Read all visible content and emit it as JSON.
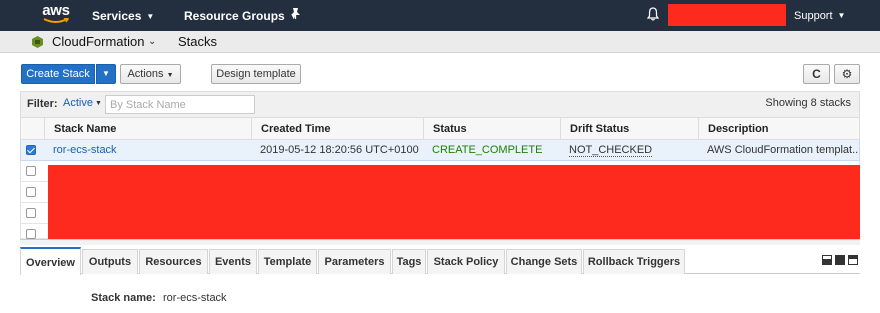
{
  "topnav": {
    "logo_text": "aws",
    "services_label": "Services",
    "resource_groups_label": "Resource Groups",
    "support_label": "Support"
  },
  "servicebar": {
    "service_name": "CloudFormation",
    "breadcrumb": "Stacks"
  },
  "toolbar": {
    "create_stack_label": "Create Stack",
    "actions_label": "Actions",
    "design_template_label": "Design template",
    "refresh_icon": "refresh-icon",
    "settings_icon": "gear-icon"
  },
  "filter": {
    "label": "Filter:",
    "value": "Active",
    "placeholder": "By Stack Name",
    "showing": "Showing 8 stacks"
  },
  "table": {
    "columns": [
      "Stack Name",
      "Created Time",
      "Status",
      "Drift Status",
      "Description"
    ],
    "rows": [
      {
        "selected": true,
        "stack_name": "ror-ecs-stack",
        "created_time": "2019-05-12 18:20:56 UTC+0100",
        "status": "CREATE_COMPLETE",
        "drift_status": "NOT_CHECKED",
        "description": "AWS CloudFormation templat..."
      }
    ]
  },
  "detail_tabs": [
    "Overview",
    "Outputs",
    "Resources",
    "Events",
    "Template",
    "Parameters",
    "Tags",
    "Stack Policy",
    "Change Sets",
    "Rollback Triggers"
  ],
  "detail": {
    "stack_name_label": "Stack name:",
    "stack_name_value": "ror-ecs-stack"
  },
  "colors": {
    "nav_bg": "#232f3e",
    "primary": "#2371c7",
    "status_ok": "#1d8102",
    "link": "#1a5fb4",
    "redaction": "#ff2a1e"
  }
}
